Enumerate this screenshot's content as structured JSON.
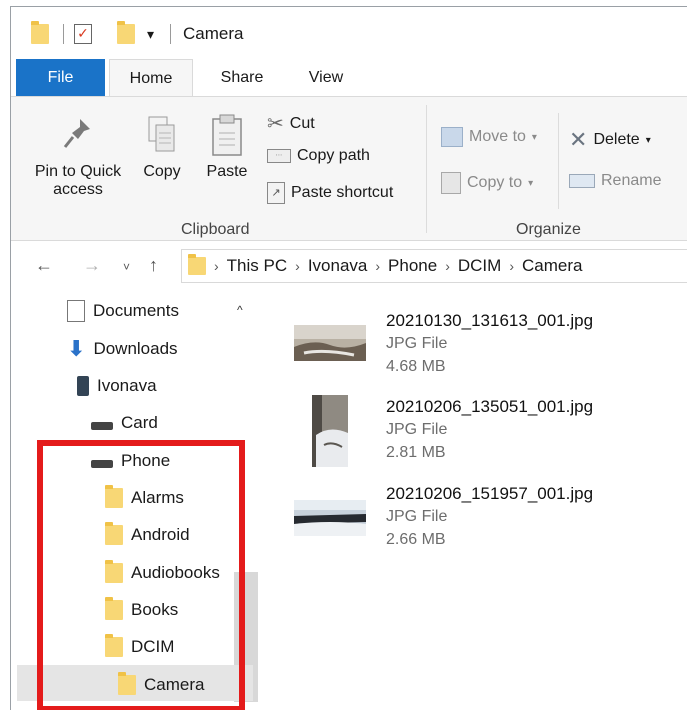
{
  "window": {
    "title": "Camera",
    "quick_access_dropdown": "▾"
  },
  "ribbon": {
    "tabs": [
      "File",
      "Home",
      "Share",
      "View"
    ],
    "clipboard": {
      "pin_label_1": "Pin to Quick",
      "pin_label_2": "access",
      "copy_label": "Copy",
      "paste_label": "Paste",
      "cut_label": "Cut",
      "copy_path_label": "Copy path",
      "paste_shortcut_label": "Paste shortcut",
      "group_label": "Clipboard"
    },
    "organize": {
      "move_to_label": "Move to",
      "copy_to_label": "Copy to",
      "delete_label": "Delete",
      "rename_label": "Rename",
      "group_label": "Organize"
    }
  },
  "address": {
    "crumbs": [
      "This PC",
      "Ivonava",
      "Phone",
      "DCIM",
      "Camera"
    ]
  },
  "nav_pane": {
    "items": [
      {
        "label": "Documents",
        "icon": "documents-icon"
      },
      {
        "label": "Downloads",
        "icon": "downloads-icon"
      },
      {
        "label": "Ivonava",
        "icon": "phone-device-icon"
      },
      {
        "label": "Card",
        "icon": "drive-icon"
      },
      {
        "label": "Phone",
        "icon": "drive-icon"
      },
      {
        "label": "Alarms",
        "icon": "folder-icon"
      },
      {
        "label": "Android",
        "icon": "folder-icon"
      },
      {
        "label": "Audiobooks",
        "icon": "folder-icon"
      },
      {
        "label": "Books",
        "icon": "folder-icon"
      },
      {
        "label": "DCIM",
        "icon": "folder-icon"
      },
      {
        "label": "Camera",
        "icon": "folder-icon"
      }
    ],
    "selected": "Camera"
  },
  "files": [
    {
      "name": "20210130_131613_001.jpg",
      "type": "JPG File",
      "size": "4.68 MB"
    },
    {
      "name": "20210206_135051_001.jpg",
      "type": "JPG File",
      "size": "2.81 MB"
    },
    {
      "name": "20210206_151957_001.jpg",
      "type": "JPG File",
      "size": "2.66 MB"
    }
  ],
  "colors": {
    "file_tab": "#1a73c8",
    "highlight_box": "#e41b1b",
    "folder": "#f8d775"
  }
}
